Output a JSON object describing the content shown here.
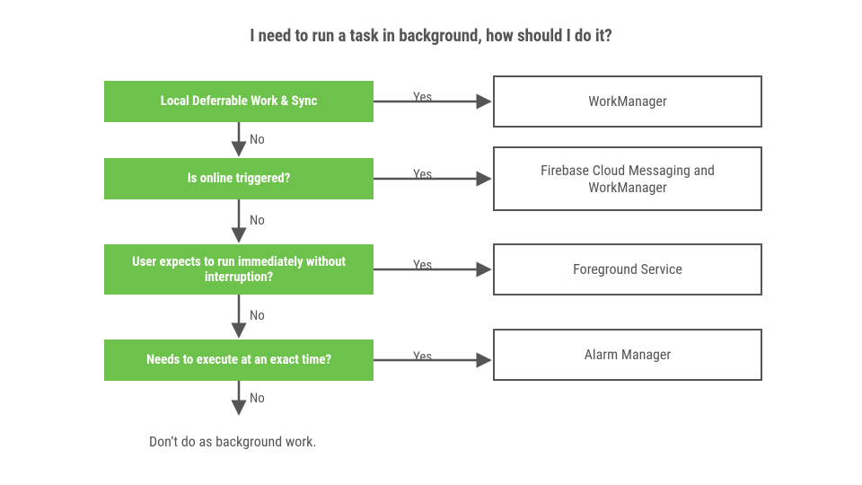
{
  "title": "I need to run a task in background, how should I do it?",
  "yes": "Yes",
  "no": "No",
  "q1": "Local Deferrable Work & Sync",
  "q2": "Is online triggered?",
  "q3": "User expects to run immediately without interruption?",
  "q4": "Needs to execute at an exact time?",
  "r1": "WorkManager",
  "r2": "Firebase Cloud Messaging and WorkManager",
  "r3": "Foreground Service",
  "r4": "Alarm Manager",
  "footnote": "Don’t do as background work.",
  "colors": {
    "accent": "#6cc24a",
    "line": "#555555"
  }
}
